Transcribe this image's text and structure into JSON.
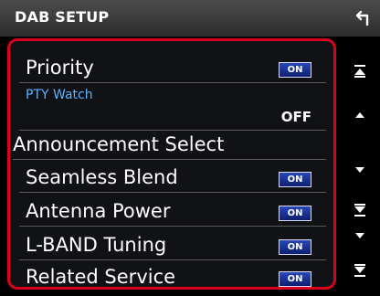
{
  "header": {
    "title": "DAB SETUP"
  },
  "settings": {
    "priority": {
      "label": "Priority",
      "value": "ON"
    },
    "pty_watch": {
      "label": "PTY Watch",
      "value": "OFF"
    },
    "announcement_select": {
      "label": "Announcement Select"
    },
    "seamless_blend": {
      "label": "Seamless Blend",
      "value": "ON"
    },
    "antenna_power": {
      "label": "Antenna Power",
      "value": "ON"
    },
    "lband_tuning": {
      "label": "L-BAND Tuning",
      "value": "ON"
    },
    "related_service": {
      "label": "Related Service",
      "value": "ON"
    }
  },
  "icons": {
    "back": "back-arrow-icon",
    "page_up": "page-up-icon",
    "scroll_up": "scroll-up-icon",
    "scroll_down": "scroll-down-icon",
    "page_down": "page-down-icon"
  },
  "colors": {
    "frame_highlight": "#d9001b",
    "toggle_on": "#1a33a0",
    "pty_label": "#5ab3ff",
    "background": "#000000",
    "title_bar": "#3c3c3c"
  }
}
